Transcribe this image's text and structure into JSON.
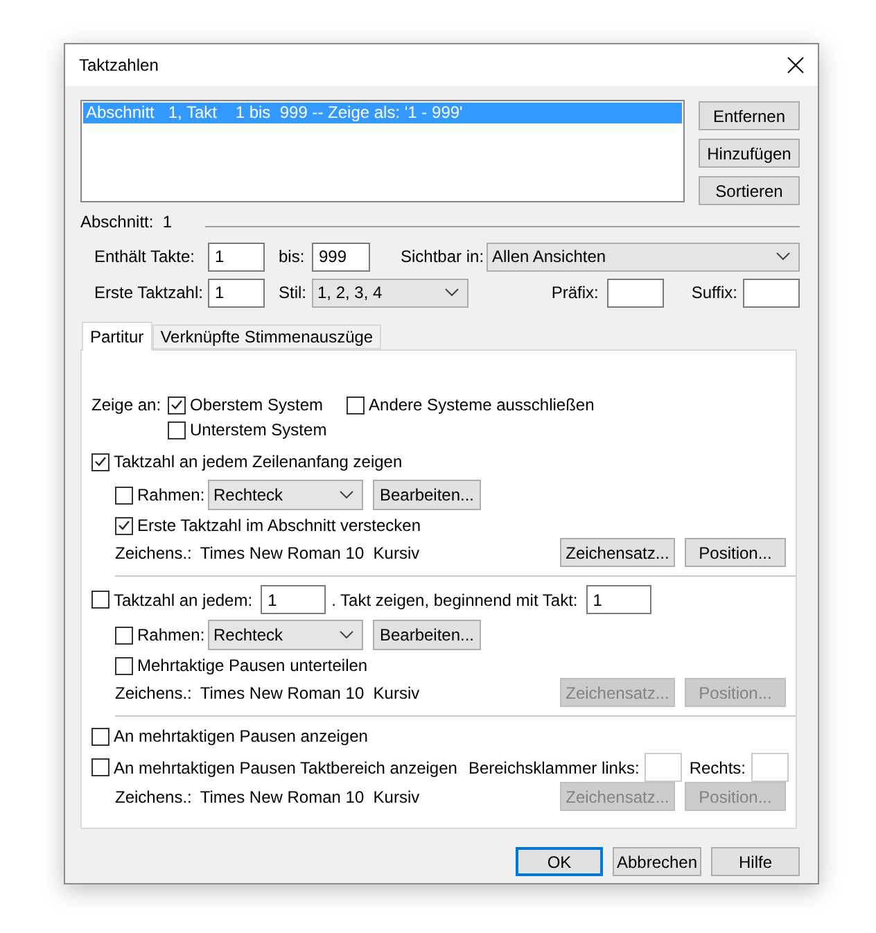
{
  "window": {
    "title": "Taktzahlen"
  },
  "sections_list": {
    "items": [
      {
        "text": "Abschnitt   1, Takt    1 bis  999 -- Zeige als: '1 - 999'",
        "selected": true
      }
    ]
  },
  "side_buttons": [
    "Entfernen",
    "Hinzufügen",
    "Sortieren"
  ],
  "section": {
    "label": "Abschnitt:",
    "value": "1"
  },
  "measures": {
    "label": "Enthält Takte:",
    "from": "1",
    "to_label": "bis:",
    "to": "999"
  },
  "visible_in": {
    "label": "Sichtbar in:",
    "value": "Allen Ansichten"
  },
  "first_number": {
    "label": "Erste Taktzahl:",
    "value": "1"
  },
  "style": {
    "label": "Stil:",
    "value": "1, 2, 3, 4"
  },
  "prefix": {
    "label": "Präfix:"
  },
  "suffix": {
    "label": "Suffix:"
  },
  "tabs": [
    {
      "label": "Partitur",
      "selected": true
    },
    {
      "label": "Verknüpfte Stimmenauszüge",
      "selected": false
    }
  ],
  "show_at": {
    "label": "Zeige an:",
    "options": [
      {
        "label": "Oberstem System",
        "checked": true
      },
      {
        "label": "Andere Systeme ausschließen",
        "checked": false
      },
      {
        "label": "Unterstem System",
        "checked": false
      }
    ]
  },
  "line_start": {
    "label": "Taktzahl an jedem Zeilenanfang zeigen",
    "checked": true,
    "frame": {
      "label": "Rahmen:",
      "checked": false,
      "shape": "Rechteck",
      "edit": "Bearbeiten..."
    },
    "hide_first": {
      "label": "Erste Taktzahl im Abschnitt verstecken",
      "checked": true
    },
    "font": {
      "label": "Zeichens.:",
      "value": "Times New Roman 10  Kursiv"
    },
    "buttons": [
      {
        "label": "Zeichensatz...",
        "disabled": false
      },
      {
        "label": "Position...",
        "disabled": false
      }
    ]
  },
  "every": {
    "label": "Taktzahl an jedem:",
    "checked": false,
    "interval": "1",
    "middle": ". Takt zeigen, beginnend mit Takt:",
    "start": "1",
    "frame": {
      "label": "Rahmen:",
      "checked": false,
      "shape": "Rechteck",
      "edit": "Bearbeiten..."
    },
    "split": {
      "label": "Mehrtaktige Pausen unterteilen",
      "checked": false
    },
    "font": {
      "label": "Zeichens.:",
      "value": "Times New Roman 10  Kursiv"
    },
    "buttons": [
      {
        "label": "Zeichensatz...",
        "disabled": true
      },
      {
        "label": "Position...",
        "disabled": true
      }
    ]
  },
  "multirest": {
    "show": {
      "label": "An mehrtaktigen Pausen anzeigen",
      "checked": false
    },
    "range": {
      "label": "An mehrtaktigen Pausen Taktbereich anzeigen",
      "checked": false
    },
    "left_label": "Bereichsklammer links:",
    "right_label": "Rechts:",
    "font": {
      "label": "Zeichens.:",
      "value": "Times New Roman 10  Kursiv"
    },
    "buttons": [
      {
        "label": "Zeichensatz...",
        "disabled": true
      },
      {
        "label": "Position...",
        "disabled": true
      }
    ]
  },
  "footer_buttons": [
    {
      "label": "OK",
      "default": true
    },
    {
      "label": "Abbrechen",
      "default": false
    },
    {
      "label": "Hilfe",
      "default": false
    }
  ]
}
